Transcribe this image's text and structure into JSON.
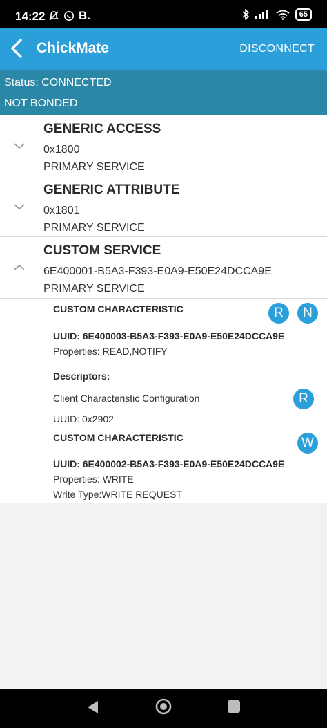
{
  "status_bar": {
    "time": "14:22",
    "left_icons": [
      "muted-notifications-icon",
      "whatsapp-icon",
      "b-app-icon"
    ],
    "b_label": "B.",
    "right_icons": [
      "bluetooth-icon",
      "signal-icon",
      "wifi-icon",
      "battery-icon"
    ],
    "battery": "65"
  },
  "app_bar": {
    "title": "ChickMate",
    "action": "DISCONNECT",
    "color": "#2b9fd9"
  },
  "connection": {
    "status": "Status: CONNECTED",
    "bond": "NOT BONDED",
    "color": "#2b87a6"
  },
  "services": [
    {
      "name": "GENERIC ACCESS",
      "uuid": "0x1800",
      "type": "PRIMARY SERVICE",
      "expanded": false
    },
    {
      "name": "GENERIC ATTRIBUTE",
      "uuid": "0x1801",
      "type": "PRIMARY SERVICE",
      "expanded": false
    },
    {
      "name": "CUSTOM SERVICE",
      "uuid": "6E400001-B5A3-F393-E0A9-E50E24DCCA9E",
      "type": "PRIMARY SERVICE",
      "expanded": true
    }
  ],
  "characteristics": [
    {
      "name": "CUSTOM CHARACTERISTIC",
      "uuid": "UUID: 6E400003-B5A3-F393-E0A9-E50E24DCCA9E",
      "properties": "Properties: READ,NOTIFY",
      "actions": [
        "R",
        "N"
      ],
      "descriptors_heading": "Descriptors:",
      "descriptor": {
        "name": "Client Characteristic Configuration",
        "uuid": "UUID: 0x2902",
        "action": "R"
      }
    },
    {
      "name": "CUSTOM CHARACTERISTIC",
      "uuid": "UUID: 6E400002-B5A3-F393-E0A9-E50E24DCCA9E",
      "properties": "Properties: WRITE",
      "write_type": "Write Type:WRITE REQUEST",
      "actions": [
        "W"
      ]
    }
  ],
  "nav_bar": {
    "buttons": [
      "back-triangle-icon",
      "home-circle-icon",
      "recents-square-icon"
    ]
  }
}
